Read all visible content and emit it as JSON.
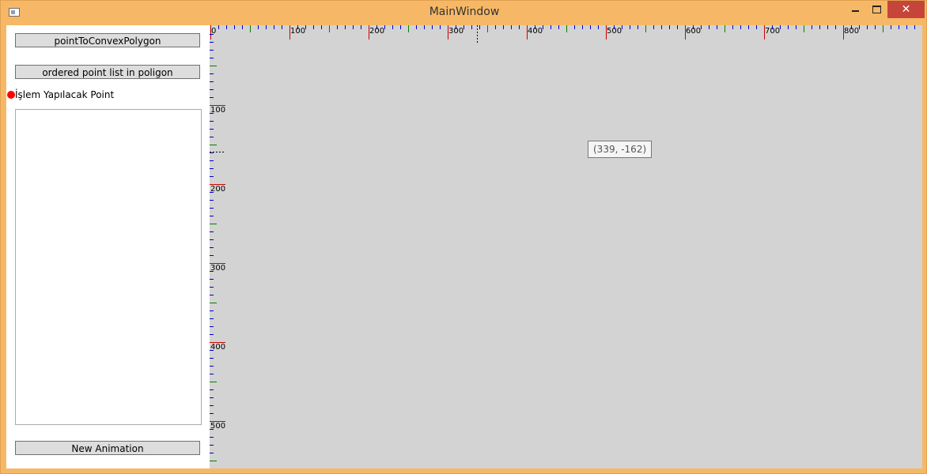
{
  "window": {
    "title": "MainWindow",
    "close_glyph": "✕"
  },
  "sidebar": {
    "button_convex": "pointToConvexPolygon",
    "button_ordered": "ordered point list in poligon",
    "point_label": "İşlem Yapılacak Point",
    "point_color": "#ff0000",
    "button_animation": "New Animation"
  },
  "canvas": {
    "background": "#d3d3d3",
    "coordinate_readout": "(339, -162)",
    "ruler_top_labels": [
      "0",
      "100",
      "200",
      "300",
      "400",
      "500",
      "600",
      "700",
      "800"
    ],
    "ruler_left_labels": [
      "100",
      "200",
      "300",
      "400",
      "500"
    ],
    "tick_colors": {
      "major": "#d00000",
      "mid": "#008000",
      "minor": "#0000c0"
    }
  }
}
